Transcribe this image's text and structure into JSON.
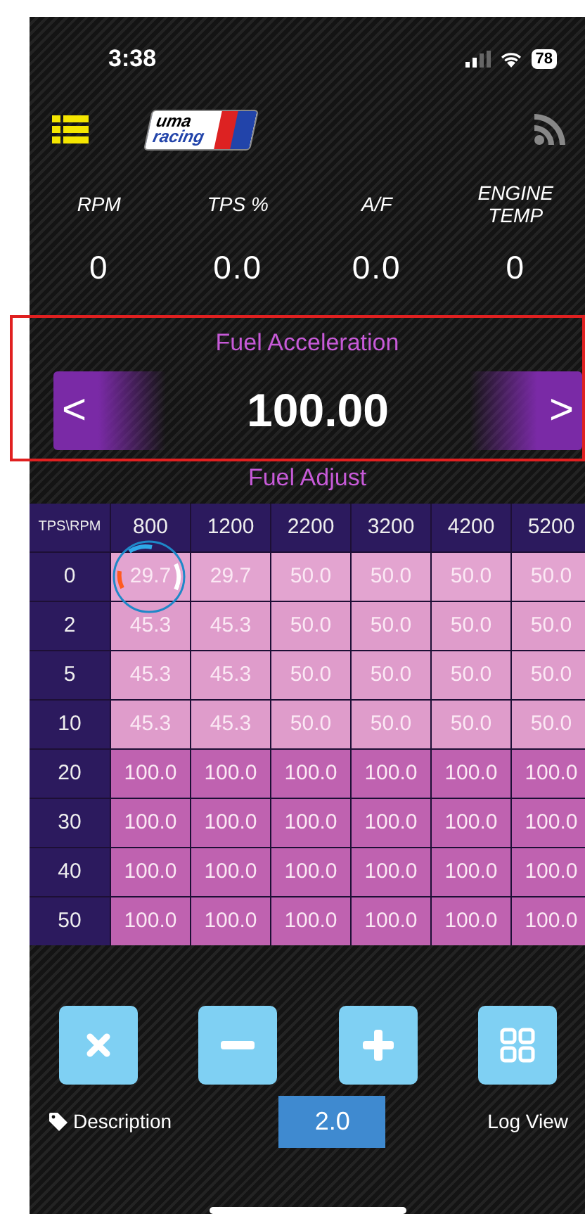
{
  "status_bar": {
    "time": "3:38",
    "battery": "78"
  },
  "header": {
    "logo": {
      "line1": "uma",
      "line2": "racing"
    }
  },
  "gauges": [
    {
      "label": "RPM",
      "value": "0"
    },
    {
      "label": "TPS %",
      "value": "0.0"
    },
    {
      "label": "A/F",
      "value": "0.0"
    },
    {
      "label": "ENGINE TEMP",
      "value": "0"
    }
  ],
  "selector": {
    "title": "Fuel Acceleration",
    "value": "100.00",
    "prev": "<",
    "next": ">",
    "highlighted": true
  },
  "table": {
    "title": "Fuel Adjust",
    "corner": "TPS\\RPM",
    "columns": [
      "800",
      "1200",
      "2200",
      "3200",
      "4200",
      "5200"
    ],
    "rows": [
      {
        "label": "0",
        "color": "#e3a4d0",
        "cells": [
          "29.7",
          "29.7",
          "50.0",
          "50.0",
          "50.0",
          "50.0"
        ]
      },
      {
        "label": "2",
        "color": "#df9ccb",
        "cells": [
          "45.3",
          "45.3",
          "50.0",
          "50.0",
          "50.0",
          "50.0"
        ]
      },
      {
        "label": "5",
        "color": "#df9ccb",
        "cells": [
          "45.3",
          "45.3",
          "50.0",
          "50.0",
          "50.0",
          "50.0"
        ]
      },
      {
        "label": "10",
        "color": "#df9ccb",
        "cells": [
          "45.3",
          "45.3",
          "50.0",
          "50.0",
          "50.0",
          "50.0"
        ]
      },
      {
        "label": "20",
        "color": "#bf62b0",
        "cells": [
          "100.0",
          "100.0",
          "100.0",
          "100.0",
          "100.0",
          "100.0"
        ]
      },
      {
        "label": "30",
        "color": "#bf62b0",
        "cells": [
          "100.0",
          "100.0",
          "100.0",
          "100.0",
          "100.0",
          "100.0"
        ]
      },
      {
        "label": "40",
        "color": "#bf62b0",
        "cells": [
          "100.0",
          "100.0",
          "100.0",
          "100.0",
          "100.0",
          "100.0"
        ]
      },
      {
        "label": "50",
        "color": "#bf62b0",
        "cells": [
          "100.0",
          "100.0",
          "100.0",
          "100.0",
          "100.0",
          "100.0"
        ]
      }
    ]
  },
  "toolbar": {
    "buttons": [
      {
        "kind": "clear"
      },
      {
        "kind": "minus"
      },
      {
        "kind": "plus"
      },
      {
        "kind": "grid"
      }
    ],
    "description": "Description",
    "step": "2.0",
    "log_view": "Log View"
  }
}
